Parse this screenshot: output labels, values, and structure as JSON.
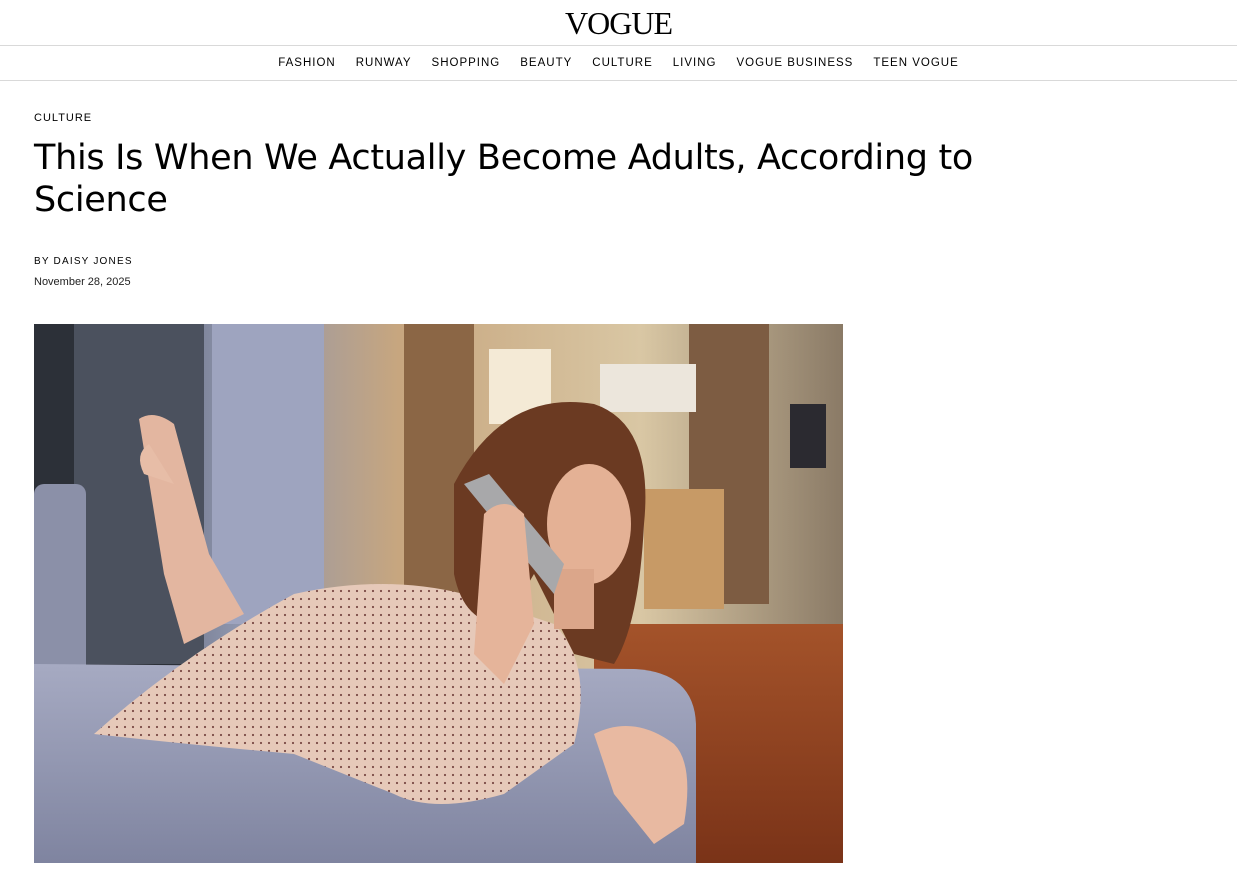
{
  "header": {
    "logo": "VOGUE"
  },
  "nav": {
    "items": [
      {
        "label": "FASHION"
      },
      {
        "label": "RUNWAY"
      },
      {
        "label": "SHOPPING"
      },
      {
        "label": "BEAUTY"
      },
      {
        "label": "CULTURE"
      },
      {
        "label": "LIVING"
      },
      {
        "label": "VOGUE BUSINESS"
      },
      {
        "label": "TEEN VOGUE"
      }
    ]
  },
  "article": {
    "rubric": "CULTURE",
    "headline": "This Is When We Actually Become Adults, According to Science",
    "byline_prefix": "BY",
    "author": "DAISY JONES",
    "date": "November 28, 2025"
  },
  "colors": {
    "text": "#000000",
    "divider": "#d9d9d9",
    "background": "#ffffff"
  }
}
